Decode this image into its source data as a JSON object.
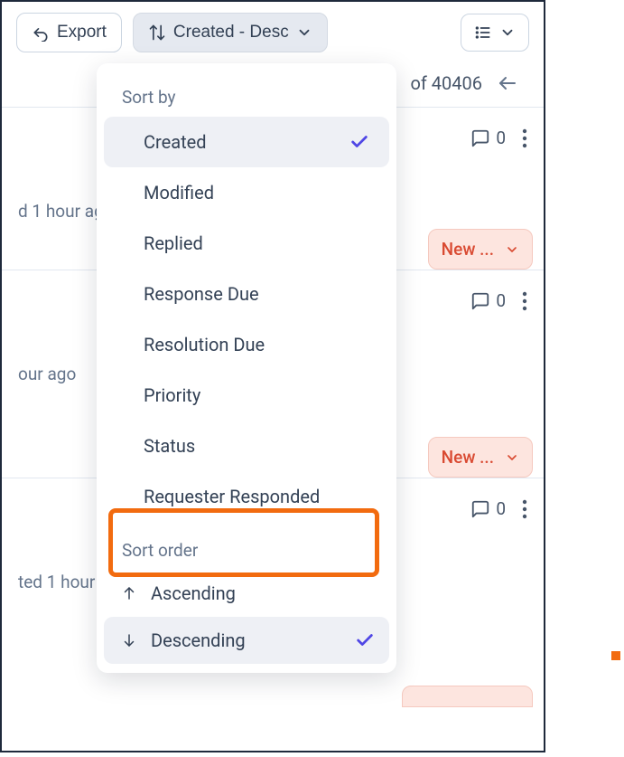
{
  "toolbar": {
    "export_label": "Export",
    "sort_label": "Created - Desc"
  },
  "header": {
    "count_text": "of 40406"
  },
  "tickets": [
    {
      "comments": "0",
      "timestamp": "d 1 hour ago",
      "status": "New ..."
    },
    {
      "comments": "0",
      "timestamp": "our ago",
      "status": "New ..."
    },
    {
      "comments": "0",
      "timestamp": "ted 1 hour"
    }
  ],
  "dropdown": {
    "sort_by_label": "Sort by",
    "items": [
      {
        "label": "Created",
        "selected": true
      },
      {
        "label": "Modified",
        "selected": false
      },
      {
        "label": "Replied",
        "selected": false
      },
      {
        "label": "Response Due",
        "selected": false
      },
      {
        "label": "Resolution Due",
        "selected": false
      },
      {
        "label": "Priority",
        "selected": false
      },
      {
        "label": "Status",
        "selected": false
      },
      {
        "label": "Requester Responded",
        "selected": false
      }
    ],
    "order_label": "Sort order",
    "orders": [
      {
        "label": "Ascending",
        "dir": "up",
        "selected": false
      },
      {
        "label": "Descending",
        "dir": "down",
        "selected": true
      }
    ]
  }
}
